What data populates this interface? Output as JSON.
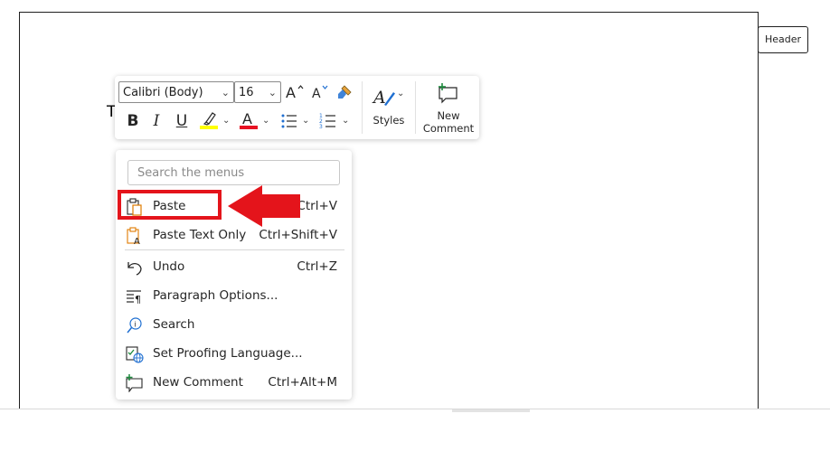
{
  "document": {
    "text_fragment": "T",
    "header_tag": "Header"
  },
  "mini_toolbar": {
    "font_name": "Calibri (Body)",
    "font_size": "16",
    "bold": "B",
    "italic": "I",
    "underline": "U",
    "styles_label": "Styles",
    "new_comment_line1": "New",
    "new_comment_line2": "Comment",
    "highlight_color": "#ffff00",
    "font_color": "#e81123"
  },
  "context_menu": {
    "search_placeholder": "Search the menus",
    "items": [
      {
        "label": "Paste",
        "shortcut": "Ctrl+V",
        "icon": "clipboard-paste-icon"
      },
      {
        "label": "Paste Text Only",
        "shortcut": "Ctrl+Shift+V",
        "icon": "clipboard-text-icon"
      },
      {
        "label": "Undo",
        "shortcut": "Ctrl+Z",
        "icon": "undo-icon"
      },
      {
        "label": "Paragraph Options...",
        "shortcut": "",
        "icon": "paragraph-icon"
      },
      {
        "label": "Search",
        "shortcut": "",
        "icon": "search-info-icon"
      },
      {
        "label": "Set Proofing Language...",
        "shortcut": "",
        "icon": "proofing-language-icon"
      },
      {
        "label": "New Comment",
        "shortcut": "Ctrl+Alt+M",
        "icon": "new-comment-icon"
      }
    ]
  },
  "annotation": {
    "highlight_color": "#e4141b"
  }
}
